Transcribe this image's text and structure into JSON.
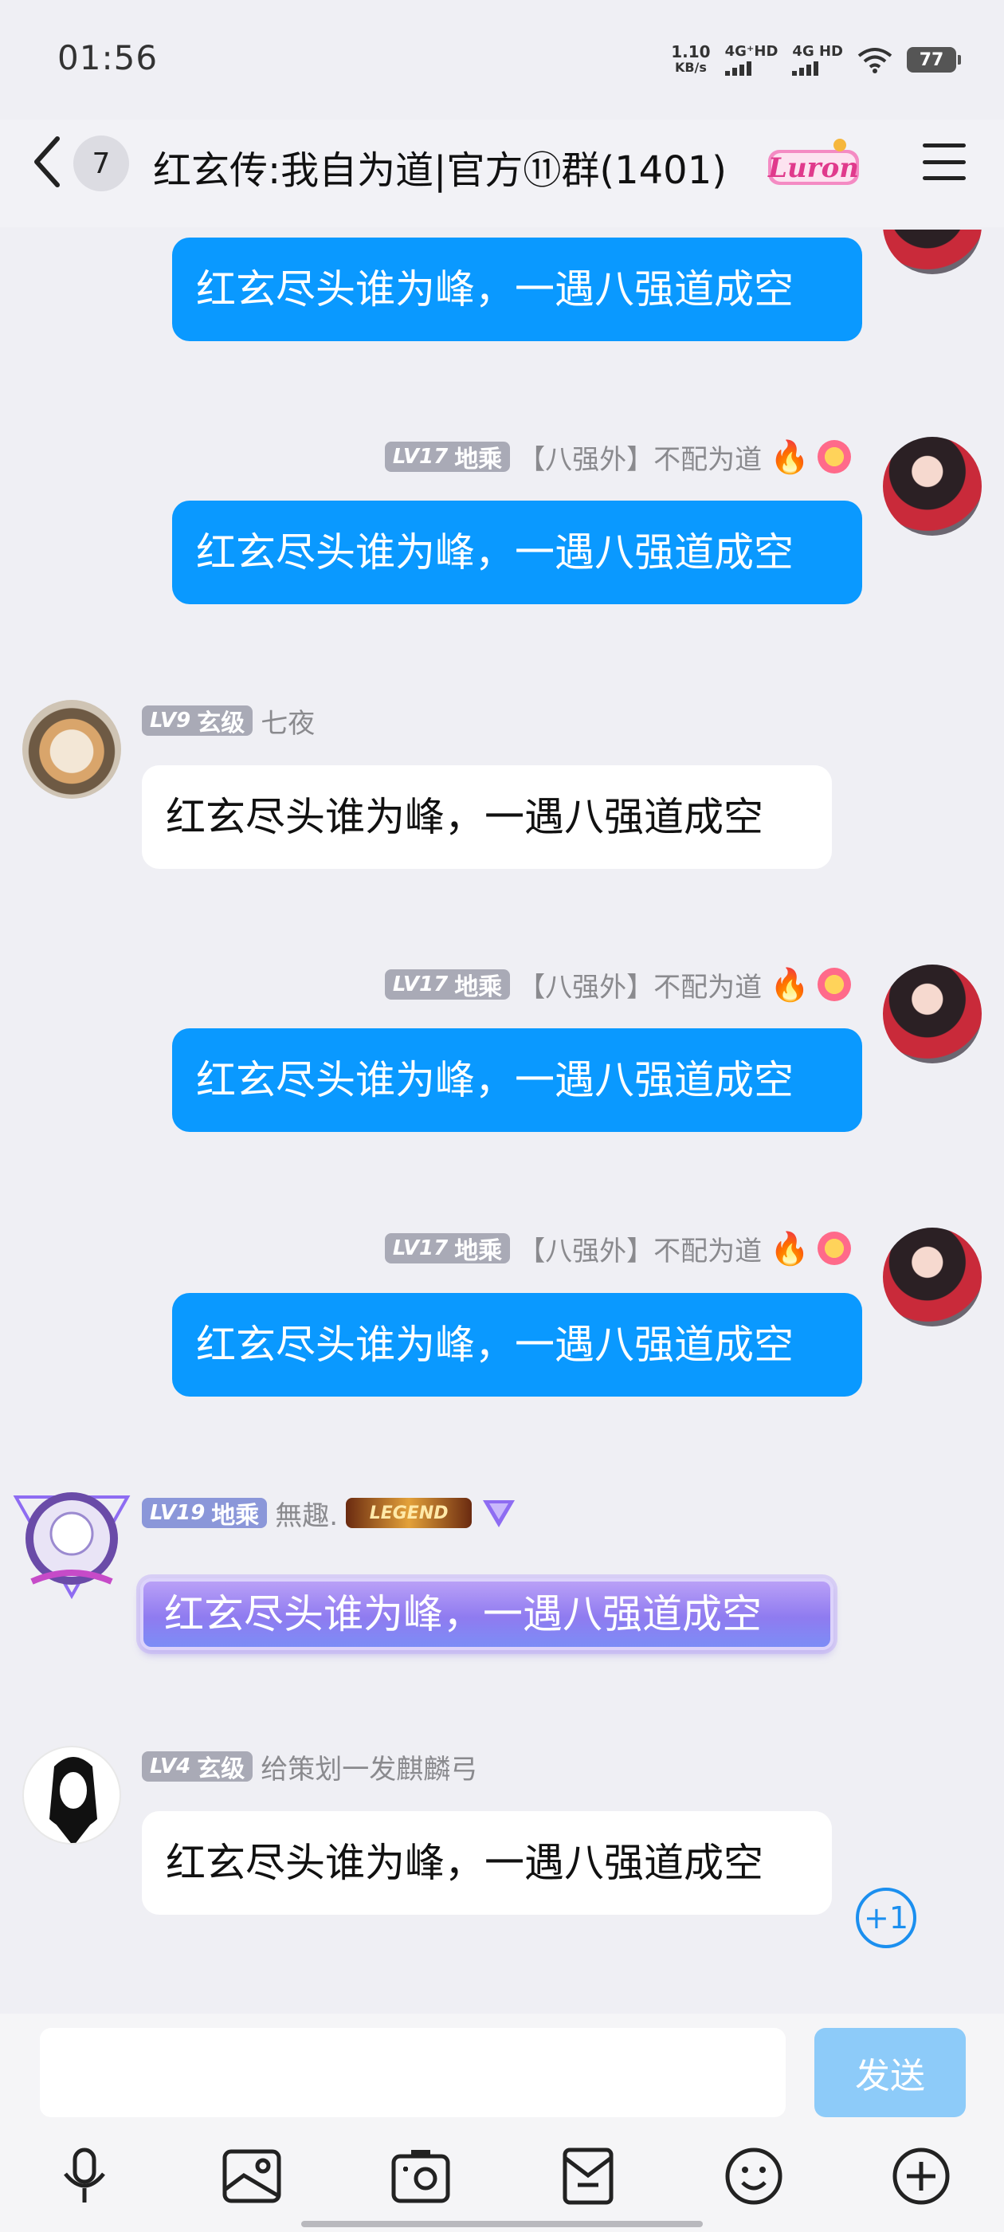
{
  "status_bar": {
    "time": "01:56",
    "speed_value": "1.10",
    "speed_unit": "KB/s",
    "net1": "4G⁺HD",
    "net2": "4G HD",
    "battery": "77"
  },
  "header": {
    "unread_count": "7",
    "title": "红玄传:我自为道|官方⑪群(1401)",
    "title_badge": "Luron"
  },
  "messages": [
    {
      "side": "right",
      "text": "红玄尽头谁为峰，一遇八强道成空"
    },
    {
      "side": "right",
      "level": "17",
      "rank": "地乘",
      "name": "【八强外】不配为道",
      "text": "红玄尽头谁为峰，一遇八强道成空"
    },
    {
      "side": "left",
      "level": "9",
      "rank": "玄级",
      "name": "七夜",
      "text": "红玄尽头谁为峰，一遇八强道成空"
    },
    {
      "side": "right",
      "level": "17",
      "rank": "地乘",
      "name": "【八强外】不配为道",
      "text": "红玄尽头谁为峰，一遇八强道成空"
    },
    {
      "side": "right",
      "level": "17",
      "rank": "地乘",
      "name": "【八强外】不配为道",
      "text": "红玄尽头谁为峰，一遇八强道成空"
    },
    {
      "side": "left",
      "level": "19",
      "rank": "地乘",
      "name": "無趣.",
      "badge": "LEGEND",
      "text": "红玄尽头谁为峰，一遇八强道成空"
    },
    {
      "side": "left",
      "level": "4",
      "rank": "玄级",
      "name": "给策划一发麒麟弓",
      "text": "红玄尽头谁为峰，一遇八强道成空"
    }
  ],
  "lv_prefix": "LV",
  "plus_one": "+1",
  "composer": {
    "input_value": "",
    "send_label": "发送"
  },
  "toolbar_icons": [
    "microphone-icon",
    "image-icon",
    "camera-icon",
    "red-packet-icon",
    "emoji-icon",
    "plus-icon"
  ],
  "colors": {
    "blue_bubble": "#0A99FF",
    "send_button": "#8DCBF9",
    "background": "#EFEFF4"
  }
}
